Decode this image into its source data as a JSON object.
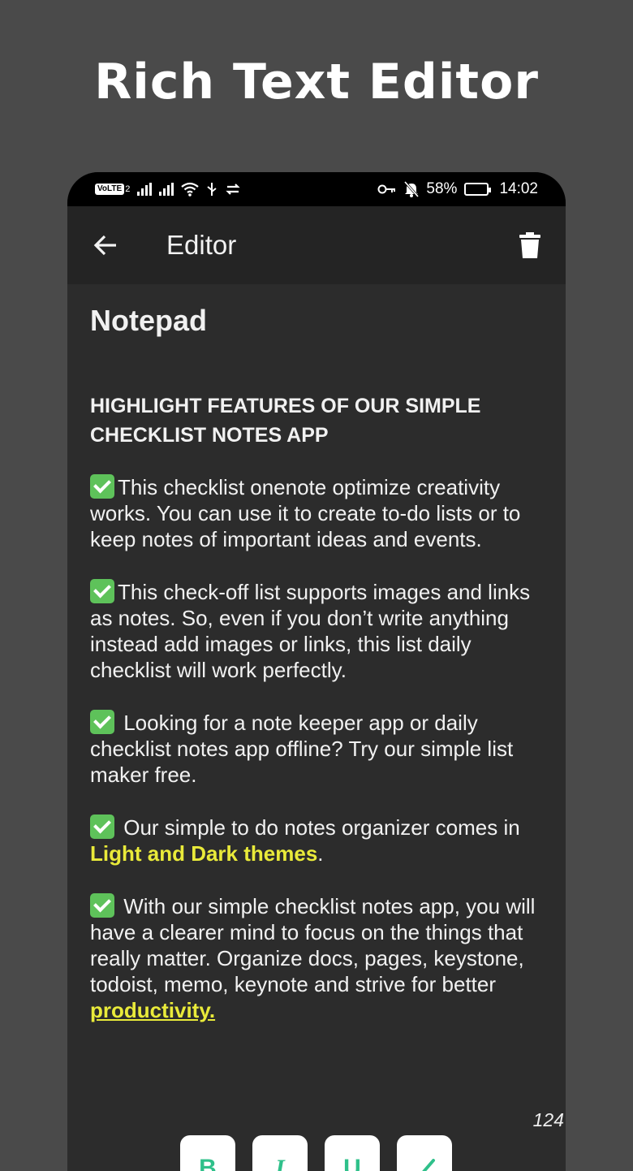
{
  "promo": {
    "title": "Rich Text Editor"
  },
  "status_bar": {
    "volte": "VoLTE",
    "sim": "2",
    "battery_percent": "58%",
    "battery_level": 0.58,
    "time": "14:02"
  },
  "toolbar": {
    "title": "Editor"
  },
  "note": {
    "title": "Notepad",
    "heading": "HIGHLIGHT FEATURES OF OUR SIMPLE CHECKLIST NOTES APP",
    "p1": "This checklist onenote optimize creativity works. You can use it to create to-do lists or to keep notes of important ideas and events.",
    "p2": "This check-off list supports images and links as notes. So, even if you don’t write anything instead add images or links, this list daily checklist will work perfectly.",
    "p3": " Looking for a note keeper app or daily checklist notes app offline? Try our simple list maker free.",
    "p4_text": " Our simple to do notes organizer comes in ",
    "p4_highlight": "Light and Dark themes",
    "p4_end": ".",
    "p5_text": " With our simple checklist notes app, you will have a clearer mind to focus on the things that really matter. Organize docs, pages, keystone, todoist, memo, keynote and strive for better ",
    "p5_highlight": "productivity.",
    "char_count": "124"
  },
  "format_bar": {
    "bold_label": "B",
    "italic_label": "I",
    "underline_label": "U"
  },
  "colors": {
    "background": "#4a4a4a",
    "editor_bg": "#2c2c2c",
    "highlight": "#e9ea3a",
    "format_icon": "#2fc08a"
  }
}
